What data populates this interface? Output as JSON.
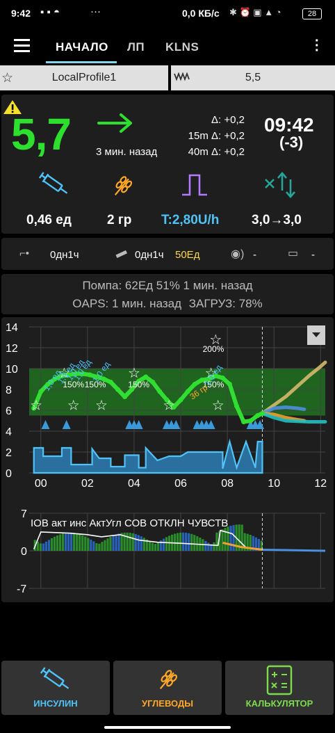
{
  "status_bar": {
    "time": "9:42",
    "network": "0,0 КБ/с",
    "battery": "28",
    "more": "···"
  },
  "tabs": [
    {
      "label": "НАЧАЛО"
    },
    {
      "label": "ЛП"
    },
    {
      "label": "KLNS"
    }
  ],
  "profile": {
    "name": "LocalProfile1",
    "target": "5,5"
  },
  "bg": {
    "value": "5,7",
    "delta": "Δ: +0,2",
    "delta15": "15m Δ: +0,2",
    "delta40": "40m Δ: +0,2",
    "ago": "3 мин. назад",
    "clock": "09:42",
    "clock_diff": "(-3)"
  },
  "tiles": {
    "iob": "0,46 ед",
    "cob": "2 гр",
    "basal": "T:2,80U/h",
    "autosens": "3,0→3,0"
  },
  "devices": {
    "cannula": "0дн1ч",
    "insulin_age": "0дн1ч",
    "reservoir": "50Ед",
    "sensor": "-",
    "battery": "-"
  },
  "status": {
    "pump": "Помпа: 62Ед 51% 1 мин. назад",
    "oaps": "OAPS: 1 мин. назад",
    "load": "ЗАГРУЗ: 78%"
  },
  "chart_data": [
    {
      "type": "line",
      "y_ticks": [
        "14",
        "12",
        "10",
        "8",
        "6",
        "4",
        "2",
        "0"
      ],
      "x_ticks": [
        "00",
        "02",
        "04",
        "06",
        "08",
        "10",
        "12"
      ],
      "ylim": [
        0,
        14
      ],
      "xlim": [
        -0.5,
        12.2
      ],
      "target_range": [
        5.5,
        10
      ],
      "annotations": [
        "150%",
        "150%",
        "150%",
        "200%",
        "150%",
        "36 гр"
      ],
      "bolus_labels": [
        "1,0 ед",
        "1,0 ед",
        "1,0 ед",
        "1,0 ед",
        "1,0 ед",
        "1,0 ед"
      ],
      "series": [
        {
          "color": "#33dd33",
          "x": [
            -0.3,
            0,
            0.3,
            0.6,
            0.9,
            1.2,
            1.5,
            1.8,
            2.1,
            2.4,
            2.7,
            3.0,
            3.3,
            3.6,
            3.9,
            4.2,
            4.5,
            4.8,
            5.1,
            5.4,
            5.7,
            6.0,
            6.3,
            6.6,
            6.9,
            7.2,
            7.5,
            7.8,
            8.1,
            8.4,
            8.7,
            9.0,
            9.3,
            9.5
          ],
          "y": [
            6.2,
            7.8,
            8.5,
            9.0,
            9.3,
            9.4,
            9.5,
            9.5,
            9.4,
            9.2,
            9.0,
            8.7,
            8.0,
            7.3,
            8.0,
            8.8,
            9.2,
            8.7,
            7.8,
            7.0,
            6.3,
            7.0,
            7.8,
            8.5,
            8.9,
            9.0,
            9.3,
            9.1,
            8.5,
            6.4,
            4.9,
            5.0,
            5.5,
            5.7
          ]
        },
        {
          "color": "#d4b86a",
          "x": [
            9.5,
            10,
            10.5,
            11,
            11.5,
            12,
            12.2
          ],
          "y": [
            5.7,
            6.5,
            7.3,
            8.3,
            9.3,
            10.2,
            10.6
          ]
        },
        {
          "color": "#4b8fe0",
          "x": [
            9.5,
            10,
            10.5,
            11,
            11.3
          ],
          "y": [
            5.7,
            6.2,
            6.3,
            6.2,
            6.1
          ]
        },
        {
          "color": "#f0a030",
          "x": [
            9.5,
            10,
            10.5,
            11,
            11.3
          ],
          "y": [
            5.7,
            5.6,
            5.3,
            5.1,
            5.0
          ]
        },
        {
          "color": "#20c0c0",
          "x": [
            9.5,
            10,
            10.5,
            11,
            11.5,
            12,
            12.2
          ],
          "y": [
            5.7,
            5.3,
            5.0,
            4.95,
            4.9,
            4.9,
            4.9
          ]
        }
      ]
    },
    {
      "type": "area",
      "legend": "IOB акт инс АктУгл СОВ ОТКЛН ЧУВСТВ",
      "y_ticks": [
        "7",
        "0",
        "-7"
      ],
      "ylim": [
        -7,
        7
      ]
    }
  ],
  "buttons": {
    "insulin": "ИНСУЛИН",
    "carbs": "УГЛЕВОДЫ",
    "calculator": "КАЛЬКУЛЯТОР"
  },
  "colors": {
    "bg_green": "#2ee02e",
    "accent": "#4fc3f7",
    "basal": "#b27aff",
    "carbs": "#ffa726",
    "calc": "#7cdc4b",
    "reservoir": "#ffd64b"
  }
}
